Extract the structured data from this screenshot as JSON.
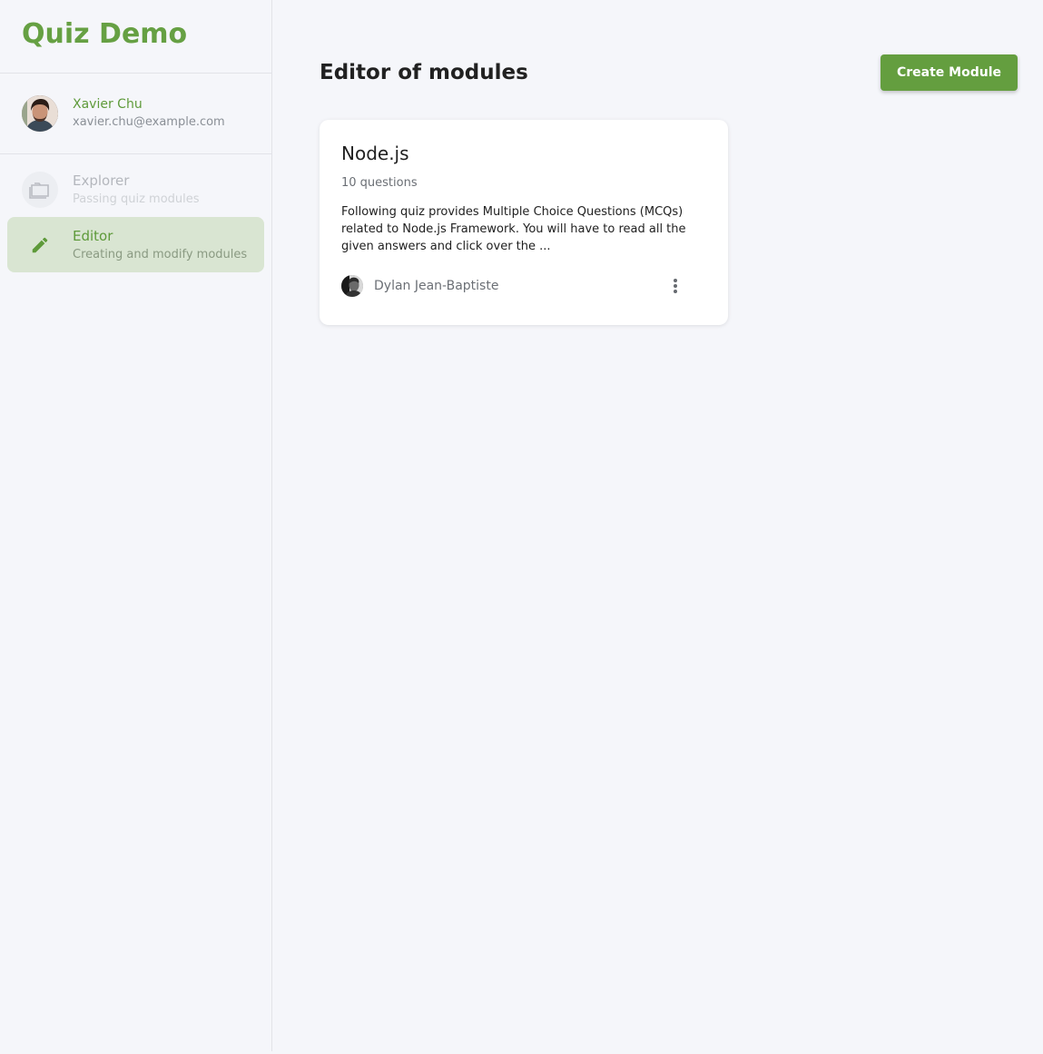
{
  "app": {
    "title": "Quiz Demo",
    "brand_color": "#66a043"
  },
  "user": {
    "name": "Xavier Chu",
    "email": "xavier.chu@example.com",
    "avatar_icon": "user-avatar"
  },
  "sidebar": {
    "items": [
      {
        "title": "Explorer",
        "subtitle": "Passing quiz modules",
        "icon": "folder-icon",
        "state": "disabled"
      },
      {
        "title": "Editor",
        "subtitle": "Creating and modify modules",
        "icon": "pencil-icon",
        "state": "active"
      }
    ]
  },
  "main": {
    "title": "Editor of modules",
    "create_button_label": "Create Module",
    "modules": [
      {
        "title": "Node.js",
        "questions": "10 questions",
        "description": "Following quiz provides Multiple Choice Questions (MCQs) related to Node.js Framework. You will have to read all the given answers and click over the ...",
        "author": "Dylan Jean-Baptiste",
        "menu_icon": "more-vertical-icon"
      }
    ]
  }
}
